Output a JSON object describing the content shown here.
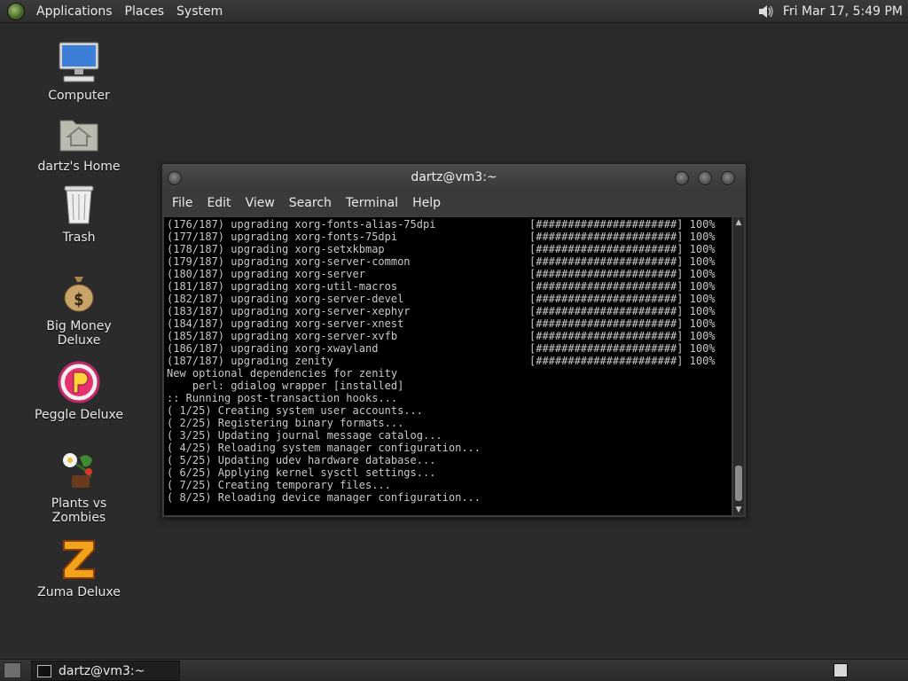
{
  "top_panel": {
    "menus": [
      "Applications",
      "Places",
      "System"
    ],
    "clock": "Fri Mar 17,  5:49 PM",
    "volume_icon": "speaker-icon"
  },
  "desktop_icons": [
    {
      "label": "Computer",
      "icon": "computer-icon"
    },
    {
      "label": "dartz's Home",
      "icon": "home-folder-icon"
    },
    {
      "label": "Trash",
      "icon": "trash-icon"
    },
    {
      "label": "Big Money Deluxe",
      "icon": "money-bag-icon"
    },
    {
      "label": "Peggle Deluxe",
      "icon": "peggle-icon"
    },
    {
      "label": "Plants vs Zombies",
      "icon": "plants-vs-zombies-icon"
    },
    {
      "label": "Zuma Deluxe",
      "icon": "zuma-icon"
    }
  ],
  "terminal": {
    "title": "dartz@vm3:~",
    "menu": [
      "File",
      "Edit",
      "View",
      "Search",
      "Terminal",
      "Help"
    ],
    "progress_bar": "[######################]",
    "progress_pct": "100%",
    "upgrade_lines": [
      "(176/187) upgrading xorg-fonts-alias-75dpi",
      "(177/187) upgrading xorg-fonts-75dpi",
      "(178/187) upgrading xorg-setxkbmap",
      "(179/187) upgrading xorg-server-common",
      "(180/187) upgrading xorg-server",
      "(181/187) upgrading xorg-util-macros",
      "(182/187) upgrading xorg-server-devel",
      "(183/187) upgrading xorg-server-xephyr",
      "(184/187) upgrading xorg-server-xnest",
      "(185/187) upgrading xorg-server-xvfb",
      "(186/187) upgrading xorg-xwayland",
      "(187/187) upgrading zenity"
    ],
    "other_lines": [
      "New optional dependencies for zenity",
      "    perl: gdialog wrapper [installed]",
      ":: Running post-transaction hooks...",
      "( 1/25) Creating system user accounts...",
      "( 2/25) Registering binary formats...",
      "( 3/25) Updating journal message catalog...",
      "( 4/25) Reloading system manager configuration...",
      "( 5/25) Updating udev hardware database...",
      "( 6/25) Applying kernel sysctl settings...",
      "( 7/25) Creating temporary files...",
      "( 8/25) Reloading device manager configuration..."
    ]
  },
  "bottom_panel": {
    "task_label": "dartz@vm3:~"
  }
}
